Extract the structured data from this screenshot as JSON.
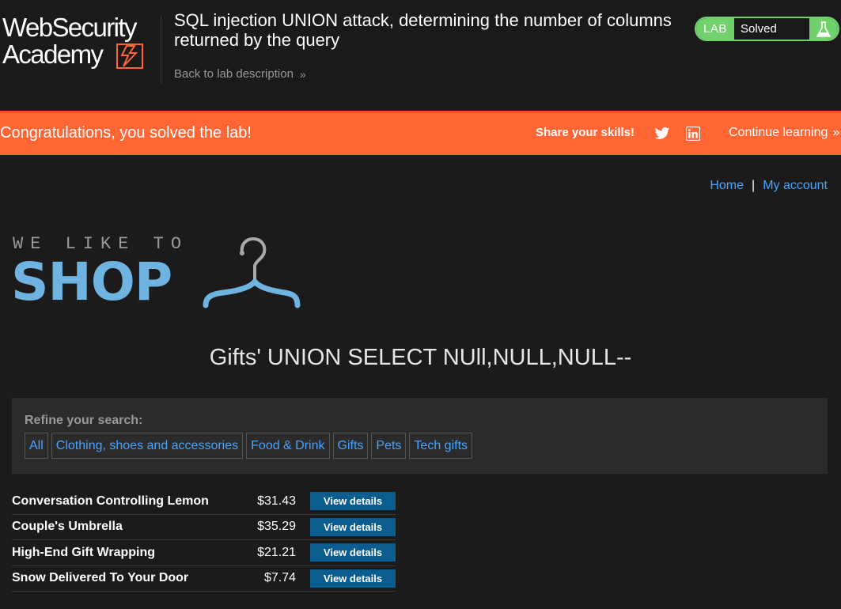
{
  "header": {
    "logo_line1": "WebSecurity",
    "logo_line2": "Academy",
    "lab_title": "SQL injection UNION attack, determining the number of columns returned by the query",
    "back_link": "Back to lab description",
    "back_chevron": "»",
    "lab_tag": "LAB",
    "lab_status": "Solved",
    "flask_icon": "flask-icon"
  },
  "banner": {
    "message": "Congratulations, you solved the lab!",
    "share": "Share your skills!",
    "continue": "Continue learning",
    "continue_chevron": "»",
    "color": "#ff6633"
  },
  "nav": {
    "home": "Home",
    "separator": "|",
    "account": "My account"
  },
  "shop_logo": {
    "tagline": "WE LIKE TO",
    "word": "SHOP"
  },
  "category_title": "Gifts' UNION SELECT NUll,NULL,NULL--",
  "filter": {
    "label": "Refine your search:",
    "categories": [
      "All",
      "Clothing, shoes and accessories",
      "Food & Drink",
      "Gifts",
      "Pets",
      "Tech gifts"
    ]
  },
  "products": [
    {
      "name": "Conversation Controlling Lemon",
      "price": "$31.43",
      "button": "View details"
    },
    {
      "name": "Couple's Umbrella",
      "price": "$35.29",
      "button": "View details"
    },
    {
      "name": "High-End Gift Wrapping",
      "price": "$21.21",
      "button": "View details"
    },
    {
      "name": "Snow Delivered To Your Door",
      "price": "$7.74",
      "button": "View details"
    }
  ],
  "colors": {
    "accent_blue": "#4aa3ff",
    "solved_green": "#70d16d",
    "button_blue": "#0b5d8f",
    "logo_orange": "#ff6633"
  }
}
